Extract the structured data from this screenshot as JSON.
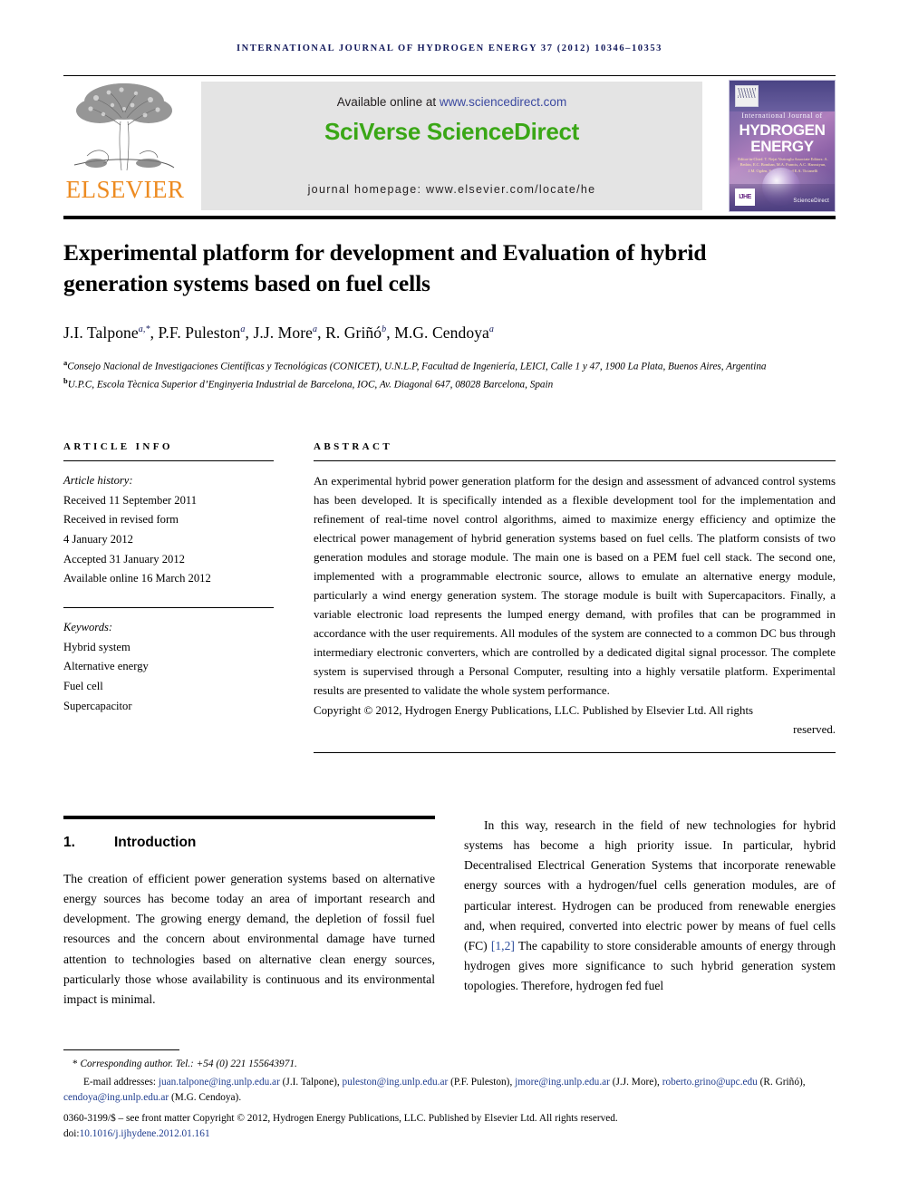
{
  "running_head": "International Journal of Hydrogen Energy 37 (2012) 10346–10353",
  "masthead": {
    "publisher_name": "ELSEVIER",
    "available_prefix": "Available online at ",
    "available_url": "www.sciencedirect.com",
    "platform_title": "SciVerse ScienceDirect",
    "homepage": "journal homepage: www.elsevier.com/locate/he",
    "cover": {
      "line1": "International Journal of",
      "line2": "HYDROGEN",
      "line3": "ENERGY",
      "editors": "Editor-in-Chief:  T. Nejat Veziroglu\nAssociate Editors:  A. Bedrin, E.C. Bomhan, M.A. Francis, A.C. Haroutyun, J.M. Ogden, S.A. Sherif and E.A. Ticianelli",
      "badge": "IJHE",
      "sciencedirect_mark": "ScienceDirect"
    }
  },
  "article": {
    "title": "Experimental platform for development and Evaluation of hybrid generation systems based on fuel cells",
    "authors": [
      {
        "name": "J.I. Talpone",
        "marks": "a,*"
      },
      {
        "name": "P.F. Puleston",
        "marks": "a"
      },
      {
        "name": "J.J. More",
        "marks": "a"
      },
      {
        "name": "R. Griñó",
        "marks": "b"
      },
      {
        "name": "M.G. Cendoya",
        "marks": "a"
      }
    ],
    "affiliations": [
      {
        "mark": "a",
        "text": "Consejo Nacional de Investigaciones Científicas y Tecnológicas (CONICET), U.N.L.P, Facultad de Ingeniería, LEICI, Calle 1 y 47, 1900 La Plata, Buenos Aires, Argentina"
      },
      {
        "mark": "b",
        "text": "U.P.C, Escola Tècnica Superior d’Enginyeria Industrial de Barcelona, IOC, Av. Diagonal 647, 08028 Barcelona, Spain"
      }
    ]
  },
  "article_info": {
    "heading": "Article info",
    "history_label": "Article history:",
    "history": [
      "Received 11 September 2011",
      "Received in revised form",
      "4 January 2012",
      "Accepted 31 January 2012",
      "Available online 16 March 2012"
    ],
    "keywords_label": "Keywords:",
    "keywords": [
      "Hybrid system",
      "Alternative energy",
      "Fuel cell",
      "Supercapacitor"
    ]
  },
  "abstract": {
    "heading": "Abstract",
    "body": "An experimental hybrid power generation platform for the design and assessment of advanced control systems has been developed. It is specifically intended as a flexible development tool for the implementation and refinement of real-time novel control algorithms, aimed to maximize energy efficiency and optimize the electrical power management of hybrid generation systems based on fuel cells. The platform consists of two generation modules and storage module. The main one is based on a PEM fuel cell stack. The second one, implemented with a programmable electronic source, allows to emulate an alternative energy module, particularly a wind energy generation system. The storage module is built with Supercapacitors. Finally, a variable electronic load represents the lumped energy demand, with profiles that can be programmed in accordance with the user requirements. All modules of the system are connected to a common DC bus through intermediary electronic converters, which are controlled by a dedicated digital signal processor. The complete system is supervised through a Personal Computer, resulting into a highly versatile platform. Experimental results are presented to validate the whole system performance.",
    "copyright_main": "Copyright © 2012, Hydrogen Energy Publications, LLC. Published by Elsevier Ltd. All rights",
    "copyright_last": "reserved."
  },
  "introduction": {
    "number": "1.",
    "title": "Introduction",
    "left_paragraph": "The creation of efficient power generation systems based on alternative energy sources has become today an area of important research and development. The growing energy demand, the depletion of fossil fuel resources and the concern about environmental damage have turned attention to technologies based on alternative clean energy sources, particularly those whose availability is continuous and its environmental impact is minimal.",
    "right_paragraph_part1": "In this way, research in the field of new technologies for hybrid systems has become a high priority issue. In particular, hybrid Decentralised Electrical Generation Systems that incorporate renewable energy sources with a hydrogen/fuel cells generation modules, are of particular interest. Hydrogen can be produced from renewable energies and, when required, converted into electric power by means of fuel cells (FC) ",
    "right_citation": "[1,2]",
    "right_paragraph_part2": " The capability to store considerable amounts of energy through hydrogen gives more significance to such hybrid generation system topologies. Therefore, hydrogen fed fuel"
  },
  "footnotes": {
    "corresponding": "Corresponding author. Tel.: +54 (0) 221 155643971.",
    "corresponding_star": "*",
    "emails_label": "E-mail addresses:",
    "emails": [
      {
        "address": "juan.talpone@ing.unlp.edu.ar",
        "owner": "(J.I. Talpone)"
      },
      {
        "address": "puleston@ing.unlp.edu.ar",
        "owner": "(P.F. Puleston)"
      },
      {
        "address": "jmore@ing.unlp.edu.ar",
        "owner": "(J.J. More)"
      },
      {
        "address": "roberto.grino@upc.edu",
        "owner": "(R. Griñó)"
      },
      {
        "address": "cendoya@ing.unlp.edu.ar",
        "owner": "(M.G. Cendoya)"
      }
    ],
    "issn_line": "0360-3199/$ – see front matter Copyright © 2012, Hydrogen Energy Publications, LLC. Published by Elsevier Ltd. All rights reserved.",
    "doi_prefix": "doi:",
    "doi": "10.1016/j.ijhydene.2012.01.161"
  },
  "colors": {
    "running_head": "#131a5c",
    "elsevier_orange": "#ed8b21",
    "sciencedirect_green": "#3aa716",
    "link_blue": "#3b49a0",
    "citation_blue": "#2b4b9b",
    "banner_gray": "#e4e4e4"
  }
}
